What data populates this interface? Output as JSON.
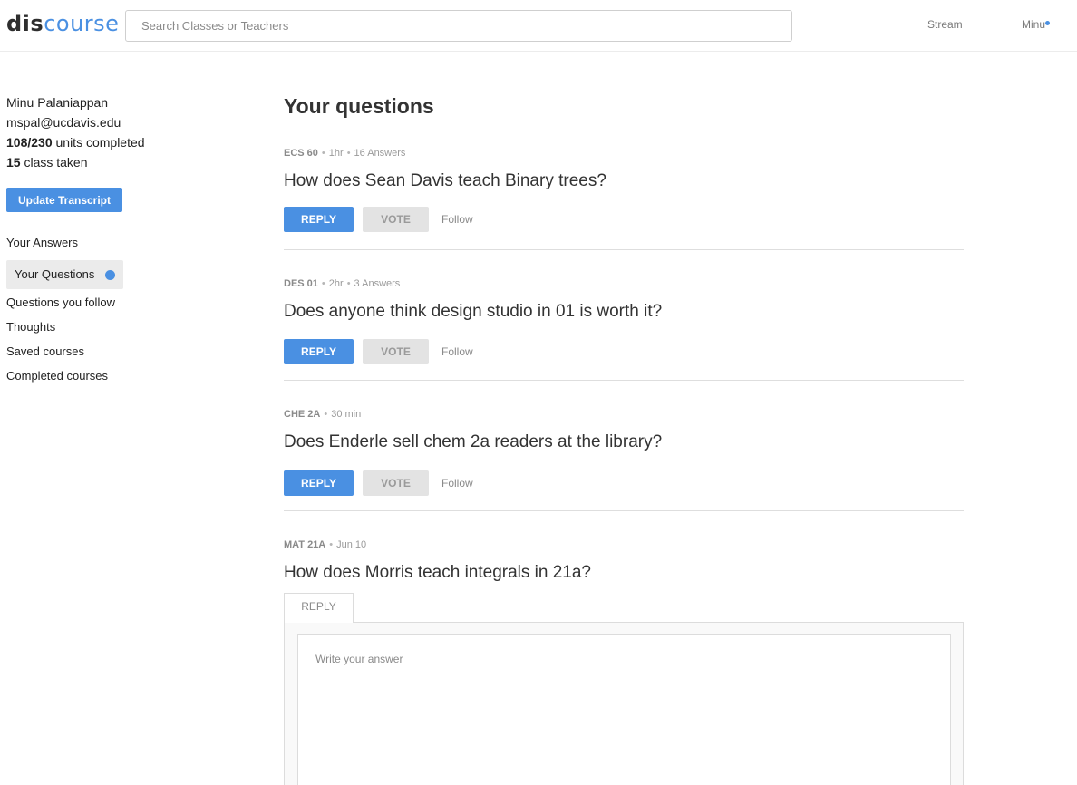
{
  "header": {
    "logo_part1": "dis",
    "logo_part2": "course",
    "search_placeholder": "Search Classes or Teachers",
    "nav_stream": "Stream",
    "nav_user": "Minu",
    "accent_color": "#4a90e2"
  },
  "profile": {
    "name": "Minu Palaniappan",
    "email": "mspal@ucdavis.edu",
    "units_value": "108/230",
    "units_label": " units completed",
    "classes_value": "15",
    "classes_label": " class taken",
    "update_button": "Update Transcript"
  },
  "sidebar": {
    "your_answers": "Your Answers",
    "your_questions": "Your Questions",
    "questions_follow": "Questions you follow",
    "thoughts": "Thoughts",
    "saved_courses": "Saved courses",
    "completed_courses": "Completed courses"
  },
  "main": {
    "title": "Your questions"
  },
  "questions": [
    {
      "course": "ECS 60",
      "time": "1hr",
      "answers": "16 Answers",
      "title": "How does Sean Davis teach Binary trees?",
      "reply": "REPLY",
      "vote": "VOTE",
      "follow": "Follow"
    },
    {
      "course": "DES 01",
      "time": "2hr",
      "answers": "3 Answers",
      "title": "Does anyone think design studio in 01 is worth it?",
      "reply": "REPLY",
      "vote": "VOTE",
      "follow": "Follow"
    },
    {
      "course": "CHE 2A",
      "time": "30 min",
      "answers": "",
      "title": "Does Enderle sell chem 2a readers at the library?",
      "reply": "REPLY",
      "vote": "VOTE",
      "follow": "Follow"
    },
    {
      "course": "MAT 21A",
      "time": "Jun 10",
      "answers": "",
      "title": "How does Morris teach integrals in 21a?"
    }
  ],
  "reply_panel": {
    "tab_label": "REPLY",
    "placeholder": "Write your answer"
  }
}
